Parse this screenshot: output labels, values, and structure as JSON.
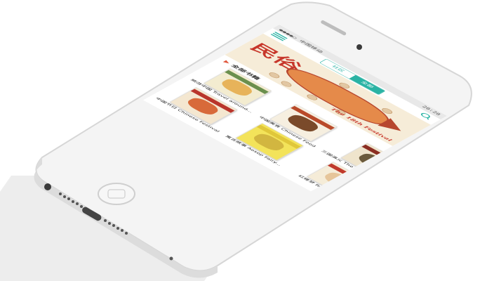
{
  "status_bar": {
    "carrier": "●●●●○ 中国移动",
    "time": "",
    "battery": "20:28"
  },
  "tabs": [
    {
      "label": "社区",
      "active": false
    },
    {
      "label": "全部",
      "active": true
    }
  ],
  "banner": {
    "title_art": "民俗",
    "caption": "The 18th Festival"
  },
  "section": {
    "title": "全部书籍"
  },
  "books": [
    {
      "title": "旅游中国 Travel around...",
      "color": "#f3ecd0",
      "band": "#6a8f4d",
      "pic": "#e7b35a"
    },
    {
      "title": "中国美食 Chinese Food",
      "color": "#f6efe0",
      "band": "#b94a2a",
      "pic": "#7a4a2a"
    },
    {
      "title": "三国演义 The Three Kingdoms",
      "color": "#efe4cc",
      "band": "#8b2e22",
      "pic": "#6b5a3c"
    },
    {
      "title": "中国节日 Chinese Festival",
      "color": "#f4e7d0",
      "band": "#b9352b",
      "pic": "#d86a3a"
    },
    {
      "title": "寓言故事 Aesop Fairy...",
      "color": "#f3e35a",
      "band": "#e0c73a",
      "pic": "#d2b640"
    },
    {
      "title": "红楼梦 Red Mansions",
      "color": "#f5ecd8",
      "band": "#c03a2c",
      "pic": "#e6c59a"
    }
  ]
}
